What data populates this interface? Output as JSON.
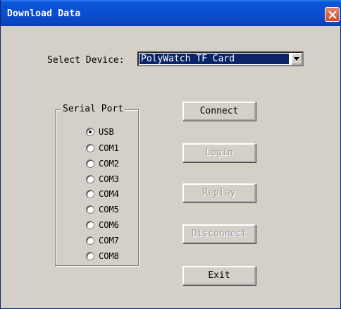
{
  "window": {
    "title": "Download Data"
  },
  "device": {
    "label": "Select Device:",
    "selected": "PolyWatch TF Card"
  },
  "serial_port": {
    "title": "Serial Port",
    "options": [
      {
        "label": "USB",
        "checked": true
      },
      {
        "label": "COM1",
        "checked": false
      },
      {
        "label": "COM2",
        "checked": false
      },
      {
        "label": "COM3",
        "checked": false
      },
      {
        "label": "COM4",
        "checked": false
      },
      {
        "label": "COM5",
        "checked": false
      },
      {
        "label": "COM6",
        "checked": false
      },
      {
        "label": "COM7",
        "checked": false
      },
      {
        "label": "COM8",
        "checked": false
      }
    ]
  },
  "buttons": {
    "connect": {
      "label": "Connect",
      "enabled": true
    },
    "login": {
      "label": "Login",
      "enabled": false
    },
    "replay": {
      "label": "Replay",
      "enabled": false
    },
    "disconnect": {
      "label": "Disconnect",
      "enabled": false
    },
    "exit": {
      "label": "Exit",
      "enabled": true
    }
  },
  "colors": {
    "titlebar": "#0b4fd0",
    "selection": "#0a246a",
    "close": "#d5461f"
  }
}
